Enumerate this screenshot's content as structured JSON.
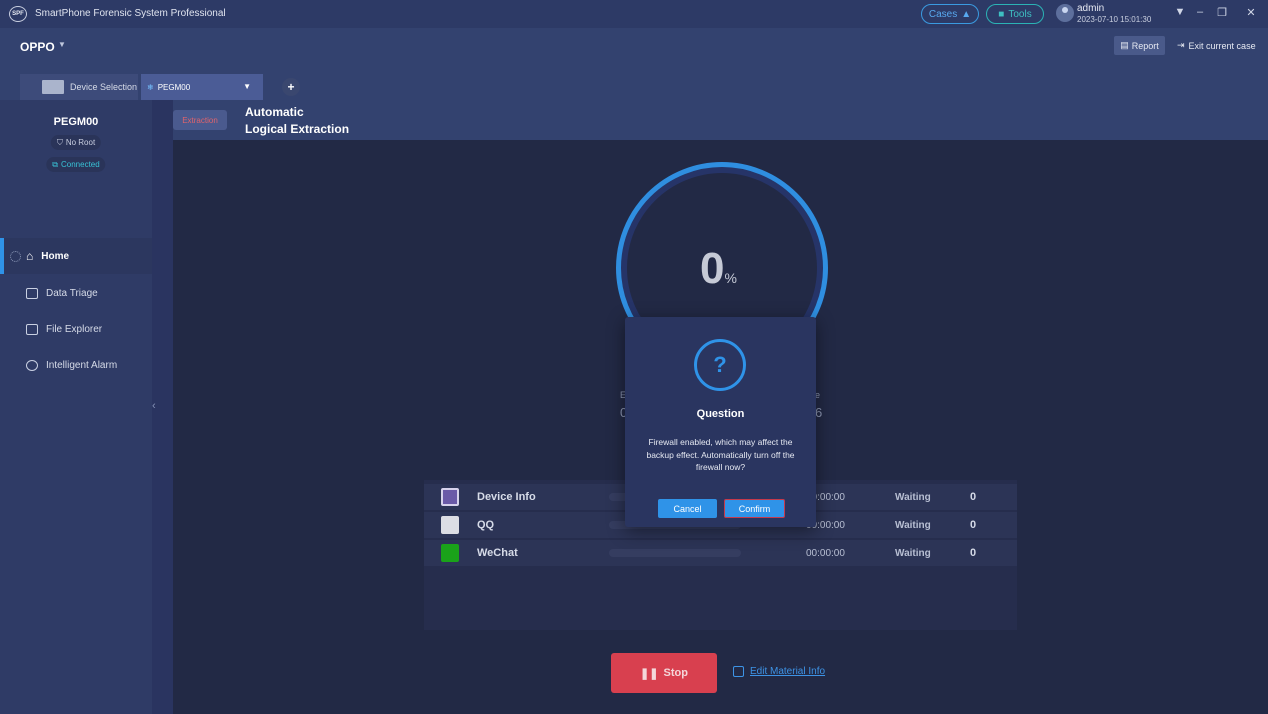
{
  "app": {
    "logo_text": "SPF",
    "title": "SmartPhone Forensic System Professional",
    "cases_label": "Cases",
    "tools_label": "Tools",
    "user": "admin",
    "datetime": "2023-07-10 15:01:30"
  },
  "header": {
    "brand": "OPPO",
    "report_label": "Report",
    "exit_label": "Exit current case",
    "device_tab_label": "Device Selection",
    "device_select_value": "PEGM00"
  },
  "sidebar": {
    "device_name": "PEGM00",
    "root_status": "No Root",
    "connection_status": "Connected",
    "items": [
      {
        "label": "Home",
        "icon": "home-icon"
      },
      {
        "label": "Data Triage",
        "icon": "document-icon"
      },
      {
        "label": "File Explorer",
        "icon": "folder-icon"
      },
      {
        "label": "Intelligent Alarm",
        "icon": "alarm-icon"
      }
    ]
  },
  "main": {
    "tag": "Extraction",
    "title_line1": "Automatic",
    "title_line2": "Logical Extraction",
    "progress_value": "0",
    "progress_unit": "%",
    "progress_fraction": 0,
    "stat_left_label": "E",
    "stat_left_value": "0",
    "stat_right_label": "e",
    "stat_right_value": "6",
    "rows": [
      {
        "name": "Device Info",
        "time": "00:00:00",
        "status": "Waiting",
        "count": "0",
        "icon": "device-info-icon"
      },
      {
        "name": "QQ",
        "time": "00:00:00",
        "status": "Waiting",
        "count": "0",
        "icon": "qq-icon"
      },
      {
        "name": "WeChat",
        "time": "00:00:00",
        "status": "Waiting",
        "count": "0",
        "icon": "wechat-icon"
      }
    ],
    "stop_label": "Stop",
    "edit_label": "Edit Material Info"
  },
  "dialog": {
    "icon": "?",
    "title": "Question",
    "message": "Firewall enabled, which may affect the backup effect. Automatically turn off the firewall now?",
    "cancel_label": "Cancel",
    "confirm_label": "Confirm"
  }
}
